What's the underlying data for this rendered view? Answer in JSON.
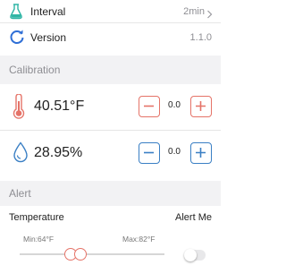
{
  "settings": {
    "interval": {
      "label": "Interval",
      "value": "2min",
      "icon": "flask-icon",
      "chevron": "chevron-right-icon"
    },
    "version": {
      "label": "Version",
      "value": "1.1.0",
      "icon": "refresh-icon"
    }
  },
  "calibration": {
    "header": "Calibration",
    "temperature": {
      "reading": "40.51°F",
      "offset": "0.0",
      "icon": "thermometer-icon",
      "color": "#e57368"
    },
    "humidity": {
      "reading": "28.95%",
      "offset": "0.0",
      "icon": "water-drop-icon",
      "color": "#3a7fc4"
    }
  },
  "alert": {
    "header": "Alert",
    "temperature_label": "Temperature",
    "alert_me_label": "Alert Me",
    "min_label": "Min:64°F",
    "max_label": "Max:82°F",
    "toggle_on": false
  },
  "colors": {
    "accent_red": "#e57368",
    "accent_blue": "#3a7fc4",
    "section_bg": "#f2f2f4",
    "teal_icon": "#2fb5a5"
  }
}
